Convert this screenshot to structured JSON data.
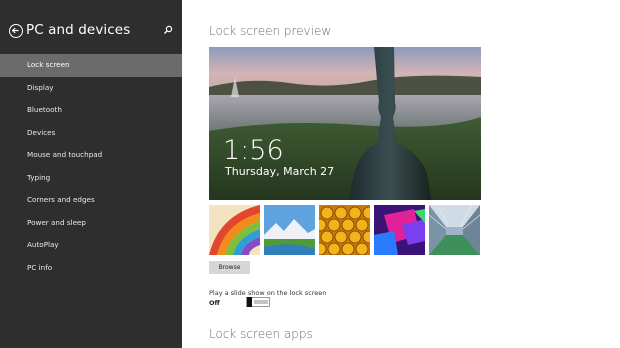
{
  "sidebar": {
    "title": "PC and devices",
    "items": [
      {
        "label": "Lock screen",
        "active": true
      },
      {
        "label": "Display"
      },
      {
        "label": "Bluetooth"
      },
      {
        "label": "Devices"
      },
      {
        "label": "Mouse and touchpad"
      },
      {
        "label": "Typing"
      },
      {
        "label": "Corners and edges"
      },
      {
        "label": "Power and sleep"
      },
      {
        "label": "AutoPlay"
      },
      {
        "label": "PC info"
      }
    ]
  },
  "main": {
    "preview_title": "Lock screen preview",
    "preview": {
      "time": "1:56",
      "date": "Thursday, March 27"
    },
    "thumbnails": [
      {
        "name": "colorful-stripes"
      },
      {
        "name": "mountain-landscape"
      },
      {
        "name": "honeycomb"
      },
      {
        "name": "neon-shapes"
      },
      {
        "name": "glass-corridor"
      }
    ],
    "browse_label": "Browse",
    "slideshow_label": "Play a slide show on the lock screen",
    "slideshow_state": "Off",
    "apps_title": "Lock screen apps"
  },
  "colors": {
    "sidebar_bg": "#2e2e2e",
    "sidebar_active_bg": "#6b6b6b",
    "section_title": "#6b6b6b"
  }
}
